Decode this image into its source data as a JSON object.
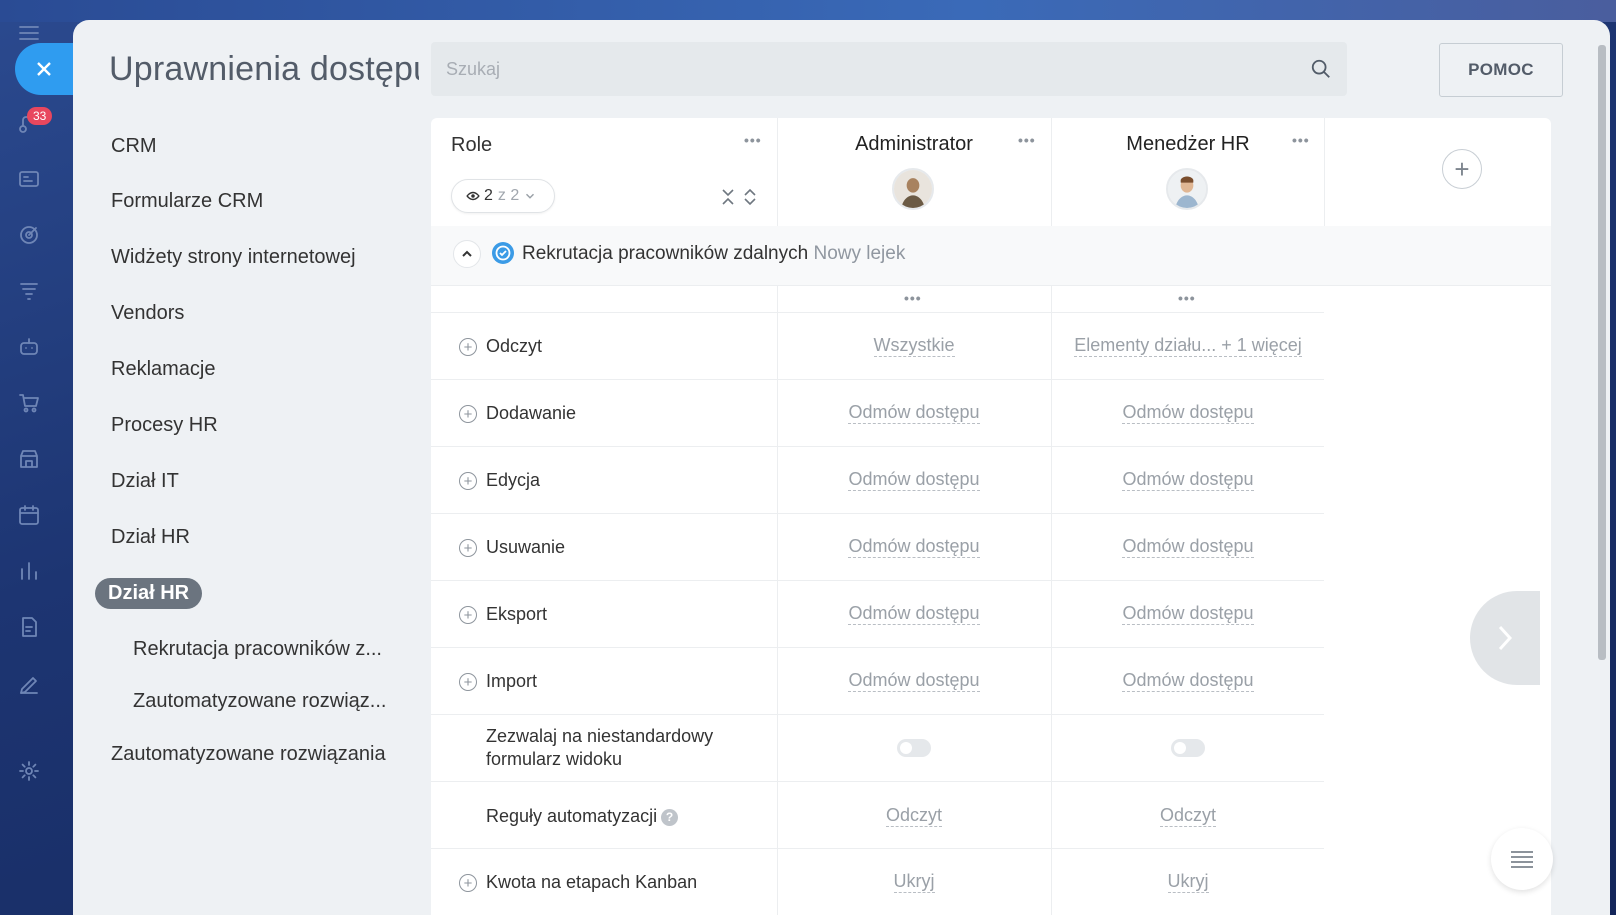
{
  "app": {
    "title": "Uprawnienia dostępu",
    "notification_count": "33"
  },
  "search": {
    "placeholder": "Szukaj"
  },
  "help_button": "POMOC",
  "menu": {
    "items": [
      "CRM",
      "Formularze CRM",
      "Widżety strony internetowej",
      "Vendors",
      "Reklamacje",
      "Procesy HR",
      "Dział IT",
      "Dział HR"
    ],
    "active": "Dział HR",
    "sub_items": [
      "Rekrutacja pracowników z...",
      "Zautomatyzowane rozwiąz..."
    ],
    "last_item": "Zautomatyzowane rozwiązania"
  },
  "table": {
    "roles_header": "Role",
    "filter": {
      "shown": "2",
      "total": "z 2"
    },
    "roles": [
      {
        "name": "Administrator"
      },
      {
        "name": "Menedżer HR"
      }
    ],
    "group": {
      "title": "Rekrutacja pracowników zdalnych",
      "tag": "Nowy lejek"
    },
    "rows": [
      {
        "label": "Odczyt",
        "values": [
          "Wszystkie",
          "Elementy działu... + 1 więcej"
        ]
      },
      {
        "label": "Dodawanie",
        "values": [
          "Odmów dostępu",
          "Odmów dostępu"
        ]
      },
      {
        "label": "Edycja",
        "values": [
          "Odmów dostępu",
          "Odmów dostępu"
        ]
      },
      {
        "label": "Usuwanie",
        "values": [
          "Odmów dostępu",
          "Odmów dostępu"
        ]
      },
      {
        "label": "Eksport",
        "values": [
          "Odmów dostępu",
          "Odmów dostępu"
        ]
      },
      {
        "label": "Import",
        "values": [
          "Odmów dostępu",
          "Odmów dostępu"
        ]
      }
    ],
    "custom_form": {
      "label_line1": "Zezwalaj na niestandardowy",
      "label_line2": "formularz widoku"
    },
    "automation": {
      "label": "Reguły automatyzacji",
      "values": [
        "Odczyt",
        "Odczyt"
      ]
    },
    "kanban": {
      "label": "Kwota na etapach Kanban",
      "values": [
        "Ukryj",
        "Ukryj"
      ]
    }
  },
  "colors": {
    "accent": "#2f9cf0",
    "active_menu": "#6b747f",
    "badge": "#e8475e"
  }
}
